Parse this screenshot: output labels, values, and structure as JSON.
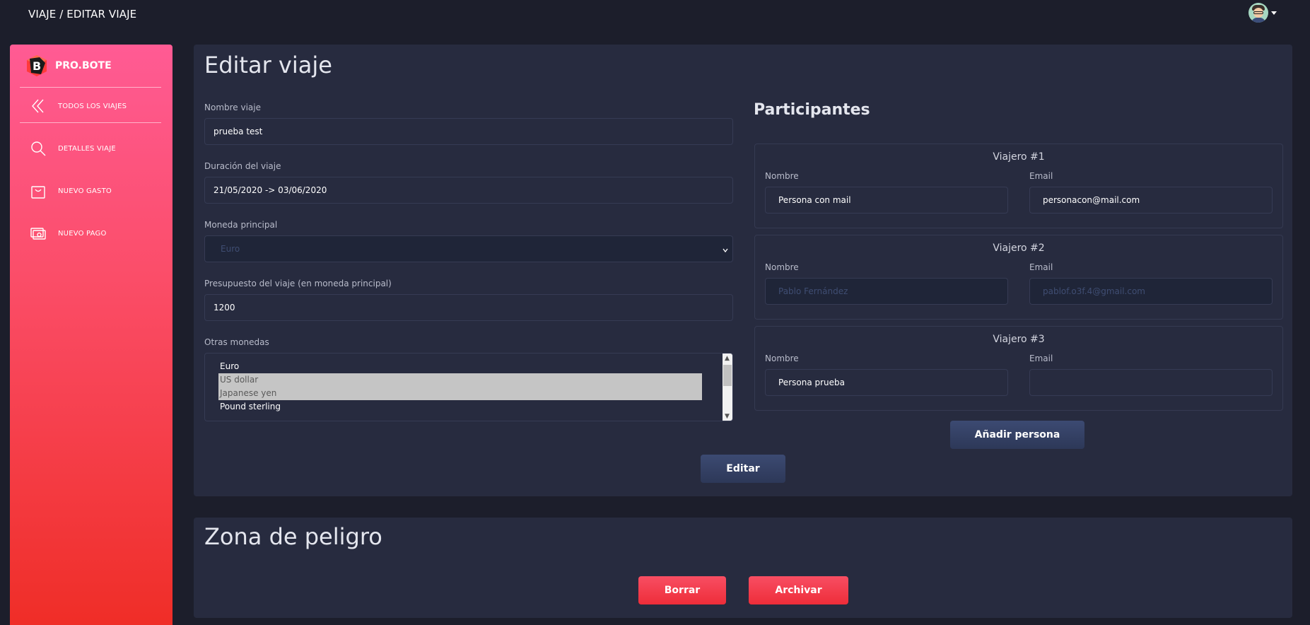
{
  "topbar": {
    "breadcrumb": "VIAJE / EDITAR VIAJE"
  },
  "sidebar": {
    "brand": "PRO.BOTE",
    "items": [
      {
        "label": "TODOS LOS VIAJES",
        "icon": "chevrons-left-icon"
      },
      {
        "label": "DETALLES VIAJE",
        "icon": "search-icon"
      },
      {
        "label": "NUEVO GASTO",
        "icon": "shopping-bag-icon"
      },
      {
        "label": "NUEVO PAGO",
        "icon": "cash-icon"
      }
    ]
  },
  "edit": {
    "title": "Editar viaje",
    "name_label": "Nombre viaje",
    "name_value": "prueba test",
    "duration_label": "Duración del viaje",
    "duration_value": "21/05/2020 -> 03/06/2020",
    "currency_label": "Moneda principal",
    "currency_value": "Euro",
    "budget_label": "Presupuesto del viaje (en moneda principal)",
    "budget_value": "1200",
    "other_label": "Otras monedas",
    "other_options": [
      {
        "label": "Euro",
        "selected": false
      },
      {
        "label": "US dollar",
        "selected": true
      },
      {
        "label": "Japanese yen",
        "selected": true
      },
      {
        "label": "Pound sterling",
        "selected": false
      }
    ],
    "submit_label": "Editar"
  },
  "participants": {
    "title": "Participantes",
    "nombre_label": "Nombre",
    "email_label": "Email",
    "travelers": [
      {
        "title": "Viajero #1",
        "name": "Persona con mail",
        "email": "personacon@mail.com",
        "disabled": false
      },
      {
        "title": "Viajero #2",
        "name": "Pablo Fernández",
        "email": "pablof.o3f.4@gmail.com",
        "disabled": true
      },
      {
        "title": "Viajero #3",
        "name": "Persona prueba",
        "email": "",
        "disabled": false
      }
    ],
    "add_label": "Añadir persona"
  },
  "danger": {
    "title": "Zona de peligro",
    "delete_label": "Borrar",
    "archive_label": "Archivar"
  },
  "colors": {
    "background": "#1c1e2b",
    "card": "#272b3f",
    "sidebar_top": "#ff5b94",
    "sidebar_bottom": "#ef2d26",
    "button_blue": "#34405f",
    "button_red": "#f43e4e"
  }
}
